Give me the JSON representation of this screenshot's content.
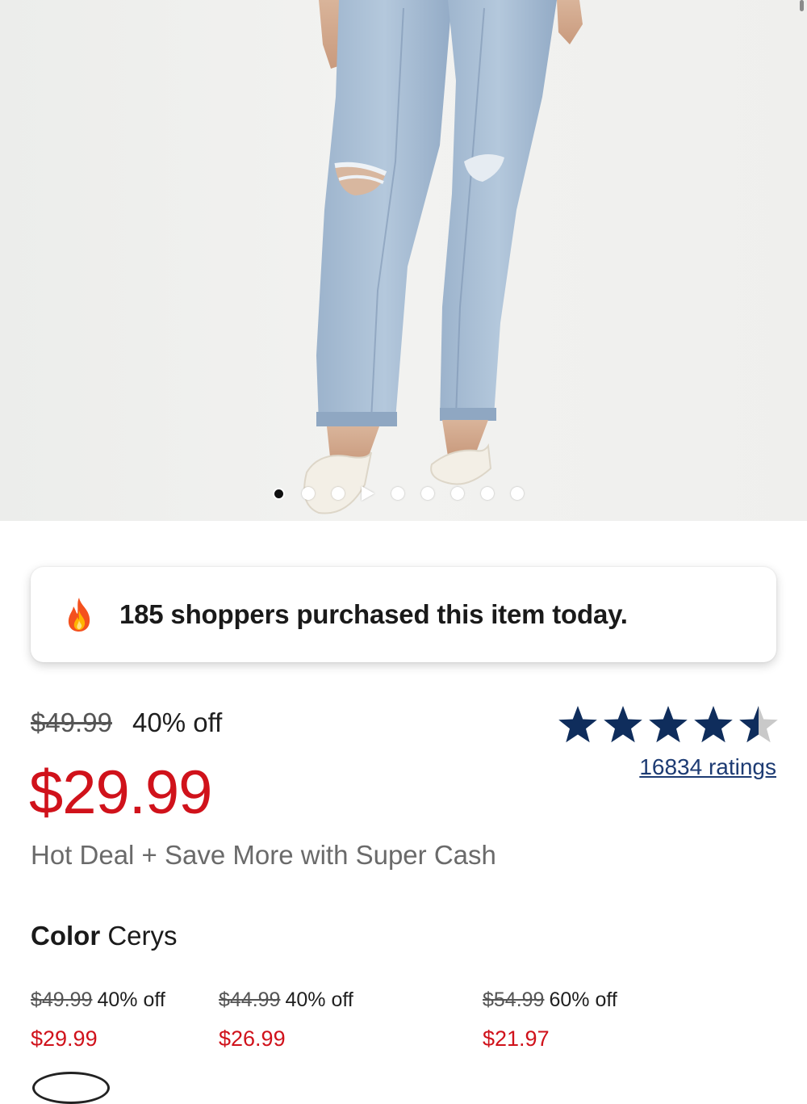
{
  "carousel": {
    "image_alt": "Model wearing light-wash distressed straight jeans with white ballet flats",
    "dots": [
      {
        "kind": "dot",
        "active": true
      },
      {
        "kind": "dot",
        "active": false
      },
      {
        "kind": "dot",
        "active": false
      },
      {
        "kind": "play",
        "active": false
      },
      {
        "kind": "dot",
        "active": false
      },
      {
        "kind": "dot",
        "active": false
      },
      {
        "kind": "dot",
        "active": false
      },
      {
        "kind": "dot",
        "active": false
      },
      {
        "kind": "dot",
        "active": false
      }
    ]
  },
  "banner": {
    "icon": "fire-icon",
    "message": "185 shoppers purchased this item today."
  },
  "price": {
    "original": "$49.99",
    "discount": "40% off",
    "current": "$29.99",
    "promo": "Hot Deal + Save More with Super Cash"
  },
  "rating": {
    "stars": 4.5,
    "max": 5,
    "count_label": "16834 ratings"
  },
  "color": {
    "label": "Color",
    "value": "Cerys"
  },
  "variants": [
    {
      "original": "$49.99",
      "discount": "40% off",
      "current": "$29.99"
    },
    {
      "original": "$44.99",
      "discount": "40% off",
      "current": "$26.99"
    },
    {
      "original": "$54.99",
      "discount": "60% off",
      "current": "$21.97"
    }
  ],
  "colors": {
    "sale_red": "#d0121b",
    "star_navy": "#0f2d5c",
    "link_navy": "#1d3b73"
  }
}
